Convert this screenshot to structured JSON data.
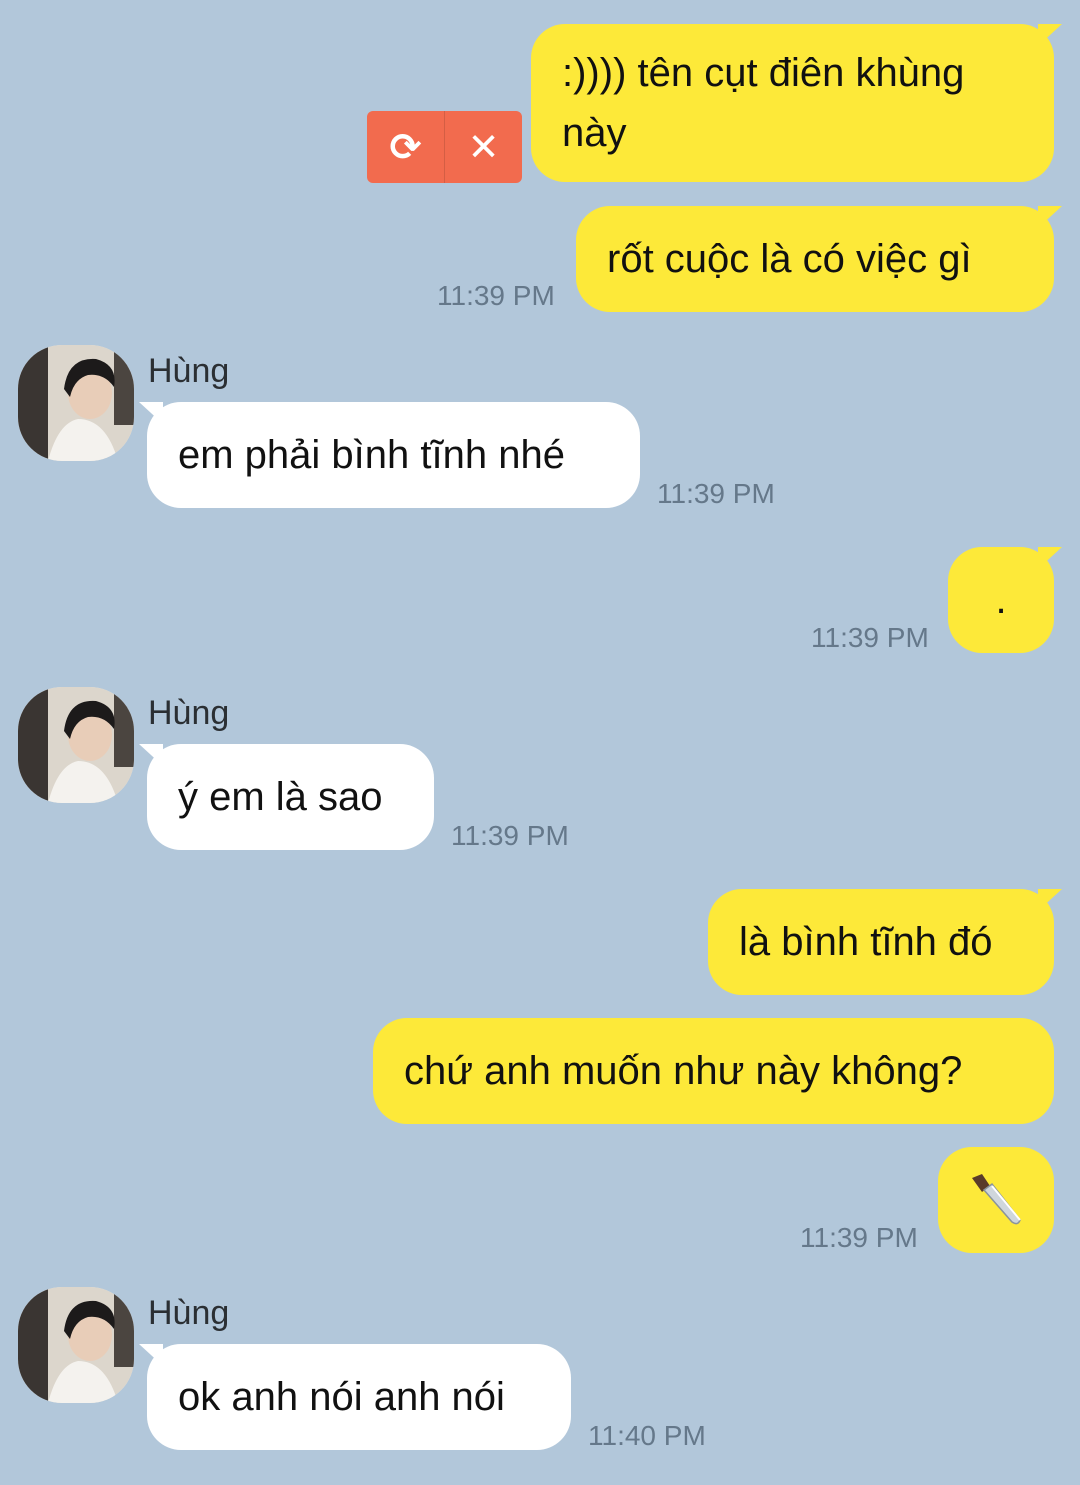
{
  "failed_actions": {
    "retry_glyph": "⟳",
    "delete_glyph": "✕"
  },
  "messages": [
    {
      "text": ":)))) tên cụt điên khùng này"
    },
    {
      "text": "rốt cuộc là có việc gì",
      "time": "11:39 PM"
    },
    {
      "sender": "Hùng",
      "text": "em phải bình tĩnh nhé",
      "time": "11:39 PM"
    },
    {
      "text": ".",
      "time": "11:39 PM"
    },
    {
      "sender": "Hùng",
      "text": "ý em là sao",
      "time": "11:39 PM"
    },
    {
      "text": "là bình tĩnh đó"
    },
    {
      "text": "chứ anh muốn như này không?"
    },
    {
      "icon": "knife-emoji",
      "time": "11:39 PM"
    },
    {
      "sender": "Hùng",
      "text": "ok anh nói anh nói",
      "time": "11:40 PM"
    }
  ]
}
